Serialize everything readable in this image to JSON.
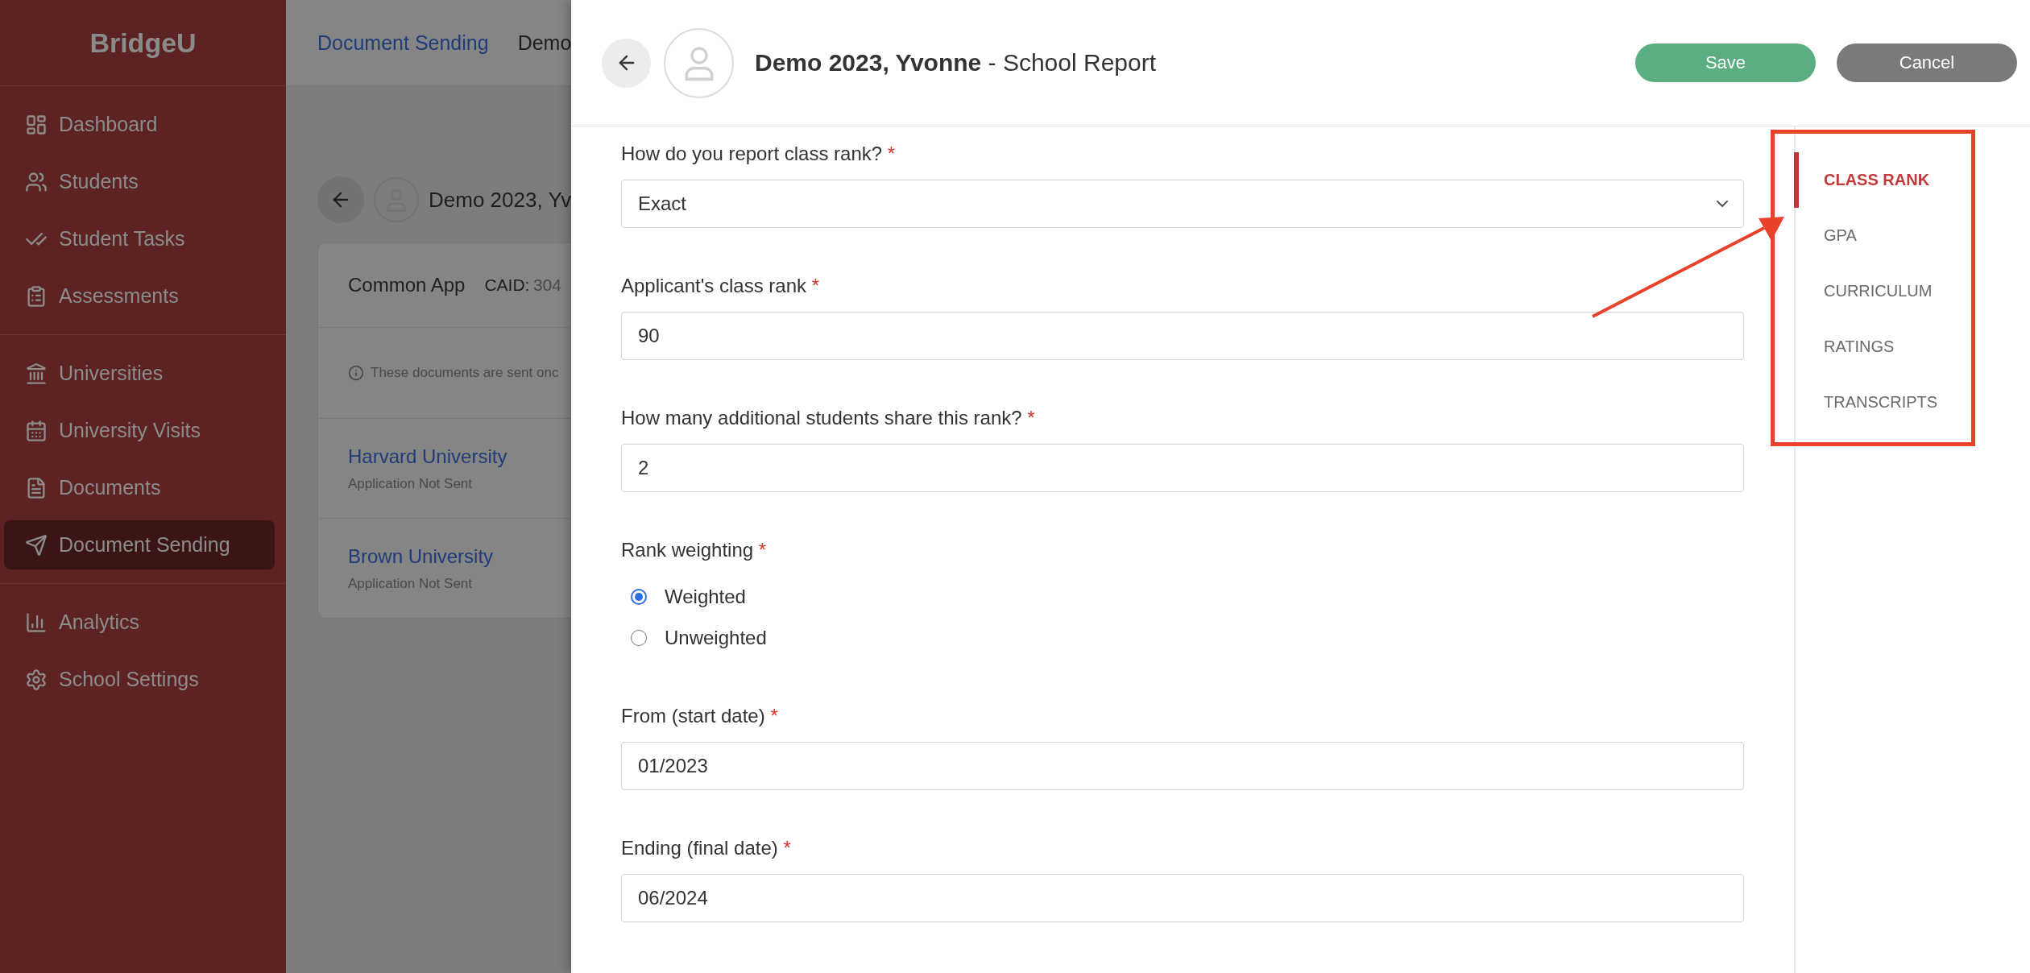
{
  "sidebar": {
    "logo": "BridgeU",
    "groups": [
      {
        "items": [
          {
            "label": "Dashboard",
            "selected": false
          },
          {
            "label": "Students",
            "selected": false
          },
          {
            "label": "Student Tasks",
            "selected": false
          },
          {
            "label": "Assessments",
            "selected": false
          }
        ]
      },
      {
        "items": [
          {
            "label": "Universities",
            "selected": false
          },
          {
            "label": "University Visits",
            "selected": false
          },
          {
            "label": "Documents",
            "selected": false
          },
          {
            "label": "Document Sending",
            "selected": true
          }
        ]
      },
      {
        "items": [
          {
            "label": "Analytics",
            "selected": false
          },
          {
            "label": "School Settings",
            "selected": false
          }
        ]
      }
    ]
  },
  "background_page": {
    "breadcrumb": [
      {
        "label": "Document Sending",
        "link": true
      },
      {
        "label": "Demo",
        "link": false
      }
    ],
    "student_name": "Demo 2023, Yv",
    "card": {
      "title": "Common App",
      "id_label": "CAID:",
      "id_value": "304",
      "notice": "These documents are sent onc",
      "universities": [
        {
          "name": "Harvard University",
          "status": "Application Not Sent"
        },
        {
          "name": "Brown University",
          "status": "Application Not Sent"
        }
      ]
    }
  },
  "drawer": {
    "title_name": "Demo 2023, Yvonne",
    "title_rest": " - School Report",
    "buttons": [
      {
        "label": "Save",
        "kind": "primary"
      },
      {
        "label": "Cancel",
        "kind": "secondary"
      }
    ],
    "fields": [
      {
        "kind": "select",
        "label": "How do you report class rank?",
        "required_mark": "*",
        "value": "Exact"
      },
      {
        "kind": "text",
        "label": "Applicant's class rank",
        "required_mark": "*",
        "value": "90"
      },
      {
        "kind": "text",
        "label": "How many additional students share this rank?",
        "required_mark": "*",
        "value": "2"
      },
      {
        "kind": "radio",
        "label": "Rank weighting",
        "required_mark": "*",
        "options": [
          {
            "label": "Weighted",
            "selected": true
          },
          {
            "label": "Unweighted",
            "selected": false
          }
        ]
      },
      {
        "kind": "text",
        "label": "From (start date)",
        "required_mark": "*",
        "value": "01/2023"
      },
      {
        "kind": "text",
        "label": "Ending (final date)",
        "required_mark": "*",
        "value": "06/2024"
      }
    ],
    "nav": [
      {
        "label": "CLASS RANK",
        "selected": true
      },
      {
        "label": "GPA",
        "selected": false
      },
      {
        "label": "CURRICULUM",
        "selected": false
      },
      {
        "label": "RATINGS",
        "selected": false
      },
      {
        "label": "TRANSCRIPTS",
        "selected": false
      }
    ]
  }
}
